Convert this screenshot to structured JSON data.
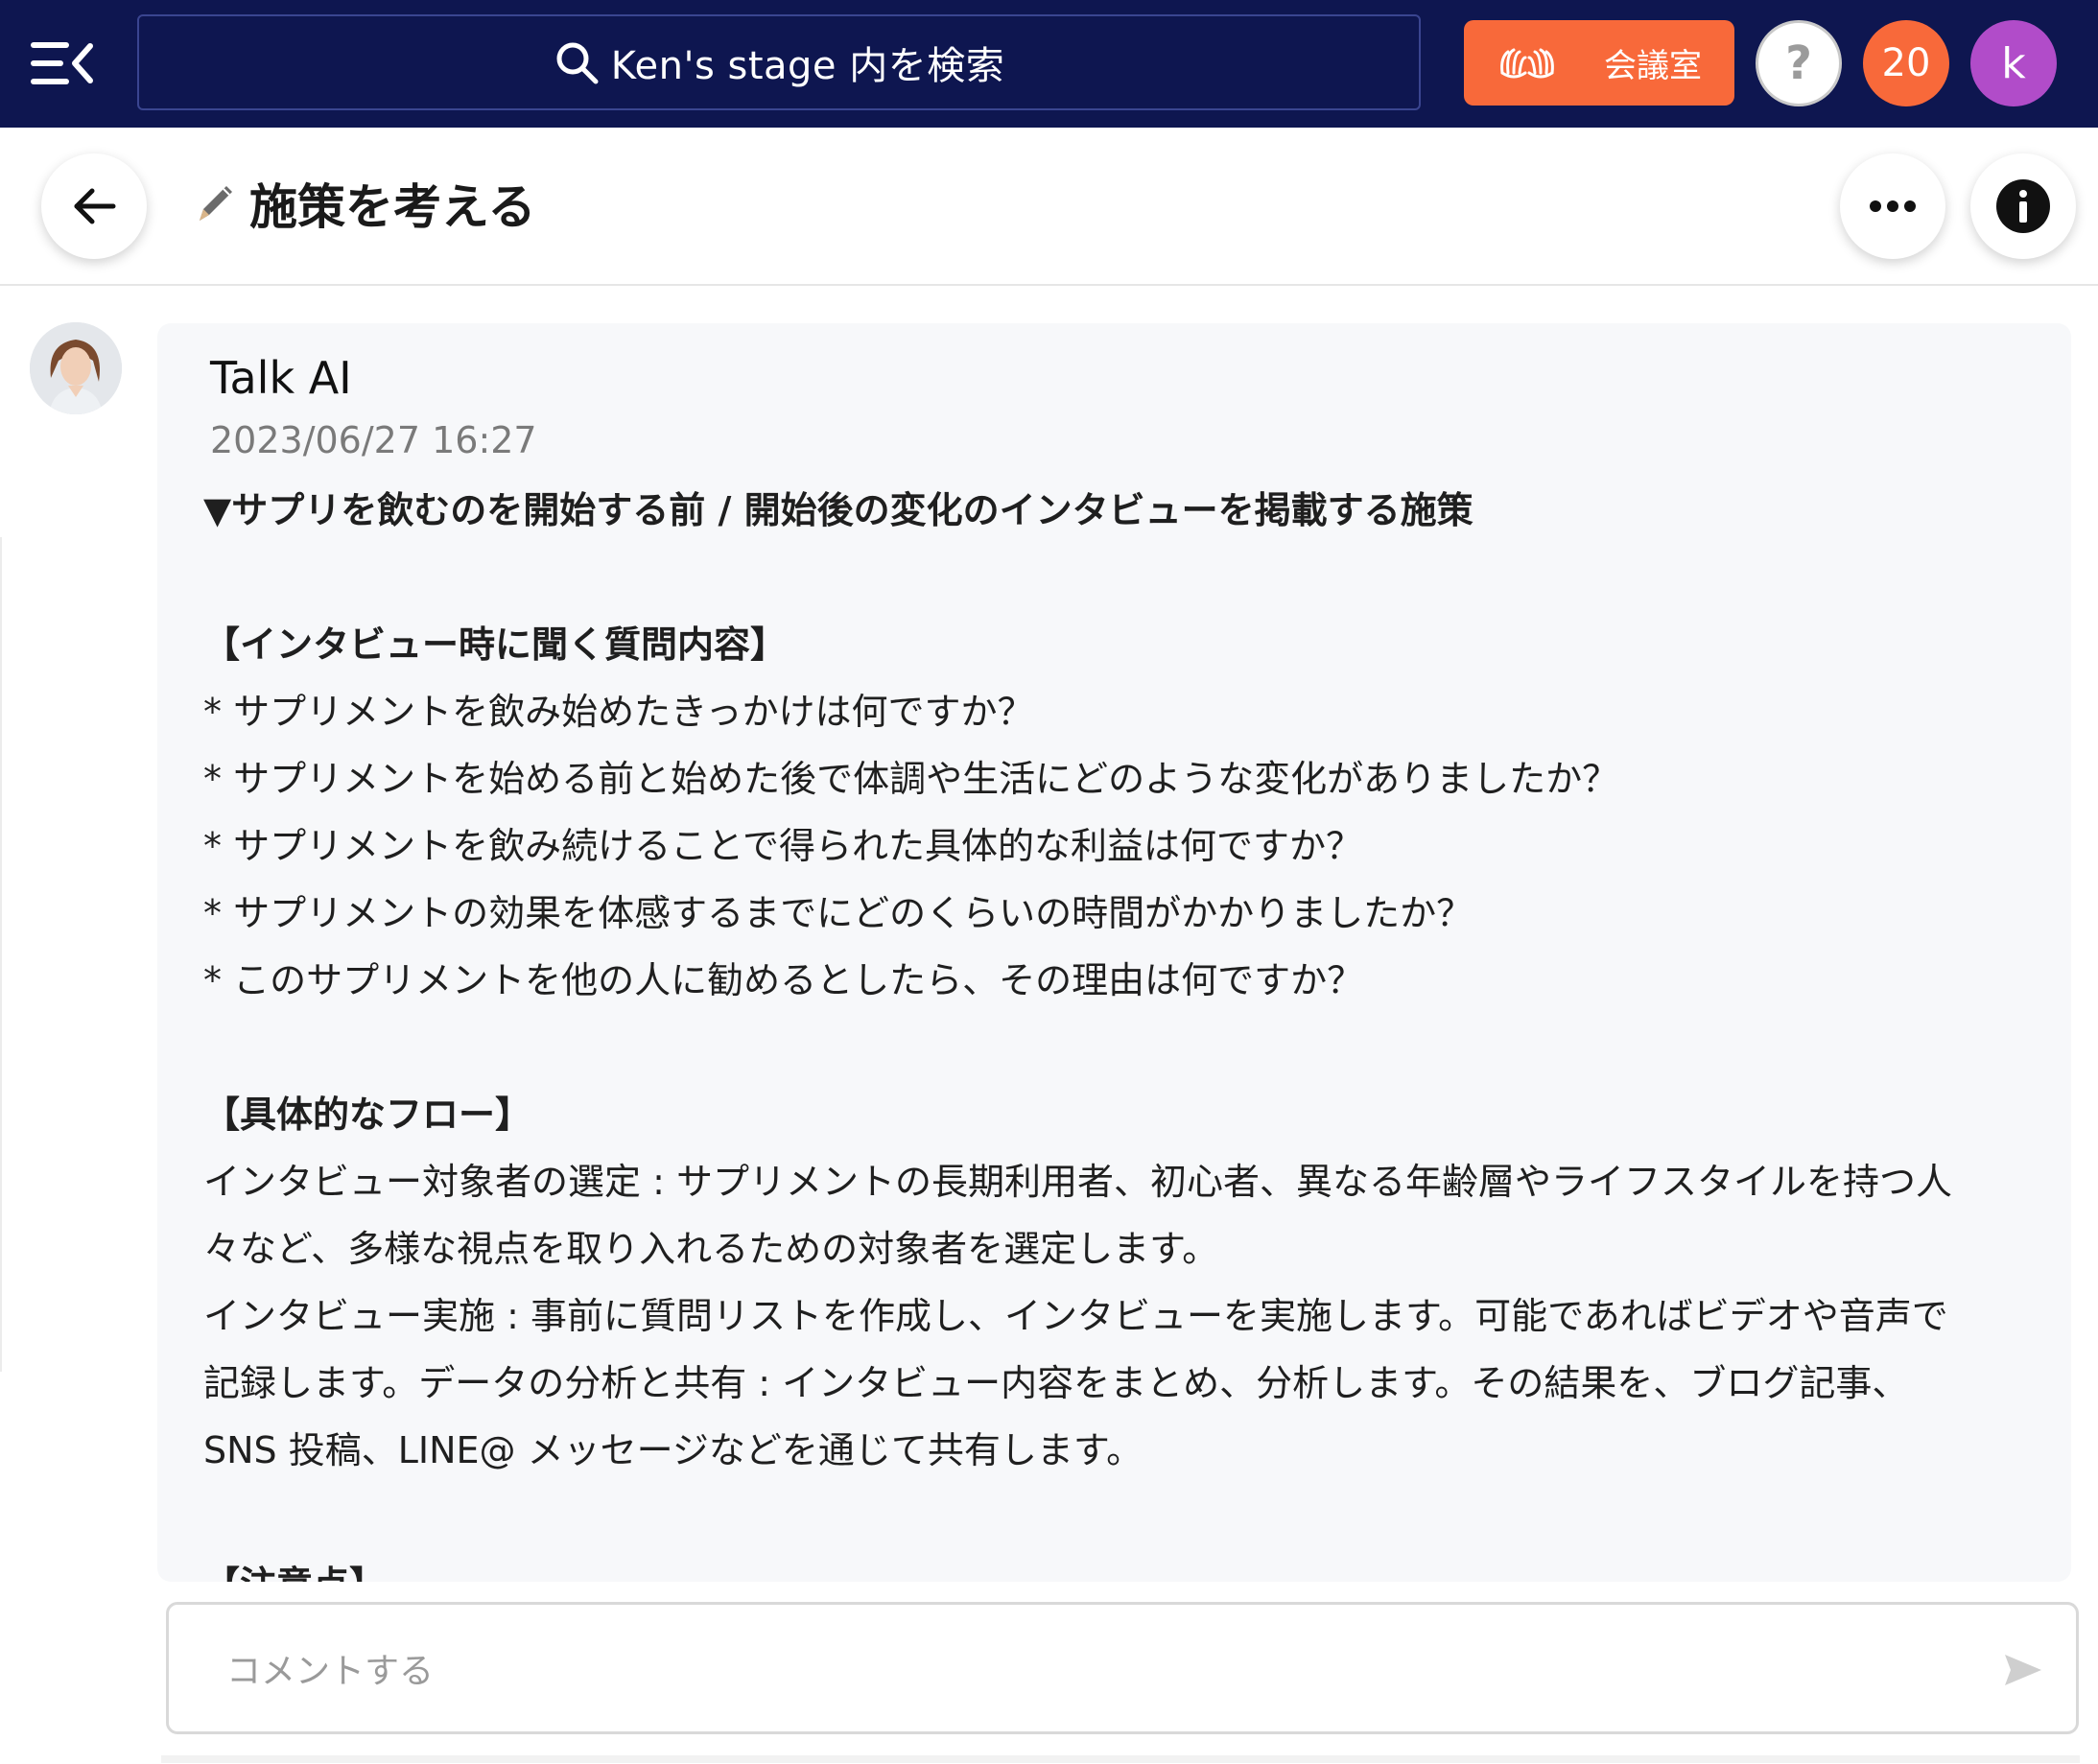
{
  "header": {
    "search_placeholder": "Ken's stage 内を検索",
    "meeting_room_label": "会議室",
    "help_label": "?",
    "notification_count": "20",
    "user_initial": "k",
    "colors": {
      "bar": "#0e1650",
      "accent": "#f8693a",
      "avatar": "#b14cc9"
    }
  },
  "page": {
    "title": "施策を考える"
  },
  "message": {
    "sender": "Talk AI",
    "timestamp": "2023/06/27 16:27",
    "lines": [
      {
        "text": "▼サプリを飲むのを開始する前 / 開始後の変化のインタビューを掲載する施策",
        "heading": true
      },
      {
        "text": ""
      },
      {
        "text": "【インタビュー時に聞く質問内容】",
        "heading": true
      },
      {
        "text": "* サプリメントを飲み始めたきっかけは何ですか？"
      },
      {
        "text": "* サプリメントを始める前と始めた後で体調や生活にどのような変化がありましたか？"
      },
      {
        "text": "* サプリメントを飲み続けることで得られた具体的な利益は何ですか？"
      },
      {
        "text": "* サプリメントの効果を体感するまでにどのくらいの時間がかかりましたか？"
      },
      {
        "text": "* このサプリメントを他の人に勧めるとしたら、その理由は何ですか？"
      },
      {
        "text": ""
      },
      {
        "text": "【具体的なフロー】",
        "heading": true
      },
      {
        "text": "インタビュー対象者の選定 : サプリメントの長期利用者、初心者、異なる年齢層やライフスタイルを持つ人"
      },
      {
        "text": "々など、多様な視点を取り入れるための対象者を選定します。"
      },
      {
        "text": "インタビュー実施 : 事前に質問リストを作成し、インタビューを実施します。可能であればビデオや音声で"
      },
      {
        "text": "記録します。データの分析と共有 : インタビュー内容をまとめ、分析します。その結果を、ブログ記事、"
      },
      {
        "text": "SNS 投稿、LINE@ メッセージなどを通じて共有します。"
      },
      {
        "text": ""
      },
      {
        "text": "【注意点】",
        "heading": true
      }
    ]
  },
  "comment": {
    "placeholder": "コメントする"
  }
}
